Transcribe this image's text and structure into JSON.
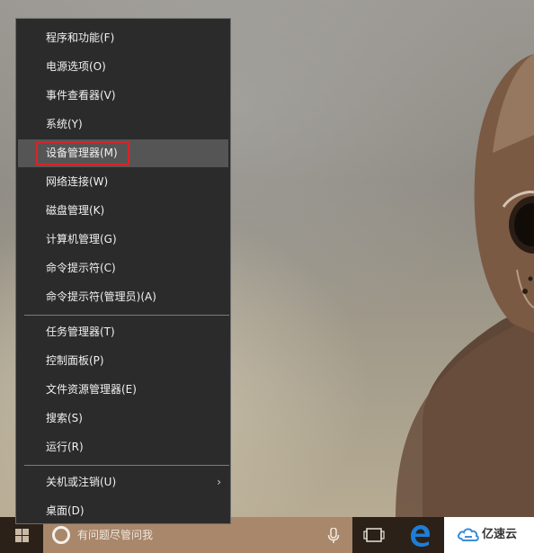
{
  "menu": {
    "items": [
      {
        "label": "程序和功能(F)"
      },
      {
        "label": "电源选项(O)"
      },
      {
        "label": "事件查看器(V)"
      },
      {
        "label": "系统(Y)"
      },
      {
        "label": "设备管理器(M)",
        "highlighted": true
      },
      {
        "label": "网络连接(W)"
      },
      {
        "label": "磁盘管理(K)"
      },
      {
        "label": "计算机管理(G)"
      },
      {
        "label": "命令提示符(C)"
      },
      {
        "label": "命令提示符(管理员)(A)"
      },
      {
        "label": "任务管理器(T)"
      },
      {
        "label": "控制面板(P)"
      },
      {
        "label": "文件资源管理器(E)"
      },
      {
        "label": "搜索(S)"
      },
      {
        "label": "运行(R)"
      },
      {
        "label": "关机或注销(U)",
        "submenu": true,
        "chevron": "›"
      },
      {
        "label": "桌面(D)"
      }
    ]
  },
  "taskbar": {
    "search_placeholder": "有问题尽管问我",
    "icons": [
      "windows-start-icon",
      "cortana-icon",
      "microphone-icon",
      "task-view-icon",
      "edge-icon"
    ]
  },
  "watermark": {
    "text": "亿速云"
  },
  "colors": {
    "menu_bg": "#2b2b2b",
    "menu_selected": "#555555",
    "highlight_box": "#d9232a",
    "taskbar": "#2b2119",
    "search_box": "#a9876b",
    "edge_blue": "#1e7ed6"
  }
}
